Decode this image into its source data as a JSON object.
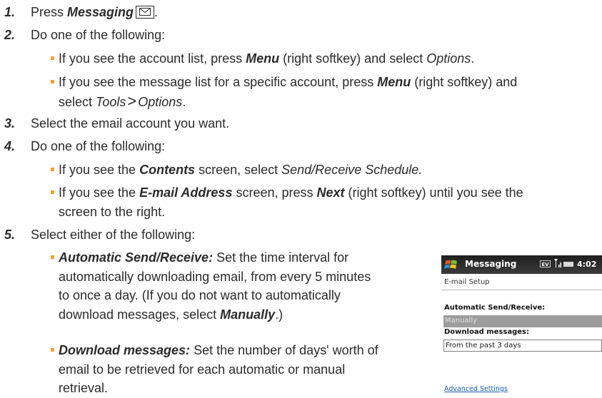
{
  "steps": [
    {
      "num": "1.",
      "parts": {
        "a": "Press ",
        "b": "Messaging"
      }
    },
    {
      "num": "2.",
      "text": "Do one of the following:"
    },
    {
      "num": "3.",
      "text": "Select the email account you want."
    },
    {
      "num": "4.",
      "text": "Do one of the following:"
    },
    {
      "num": "5.",
      "text": "Select either of the following:"
    }
  ],
  "step2_bullets": {
    "b1": {
      "a": "If you see the account list, press ",
      "b": "Menu",
      "c": " (right softkey) and select ",
      "d": "Options",
      "e": "."
    },
    "b2": {
      "a": "If you see the message list for a specific account, press ",
      "b": "Menu",
      "c": " (right softkey) and",
      "d": "select ",
      "e": "Tools",
      "f": ">",
      "g": "Options",
      "h": "."
    }
  },
  "step4_bullets": {
    "b1": {
      "a": "If you see the ",
      "b": "Contents",
      "c": " screen, select ",
      "d": "Send/Receive Schedule."
    },
    "b2": {
      "a": "If you see the ",
      "b": "E-mail Address",
      "c": " screen, press ",
      "d": "Next",
      "e": " (right softkey) until you see the",
      "f": "screen to the right."
    }
  },
  "step5_bullets": {
    "b1": {
      "label": "Automatic Send/Receive:",
      "l1": " Set the time interval for",
      "l2": "automatically downloading email, from every 5 minutes",
      "l3": "to once a day. (If you do not want to automatically",
      "l4": "download messages, select ",
      "manual": "Manually",
      "end": ".)"
    },
    "b2": {
      "label": "Download messages:",
      "l1": " Set the number of days' worth of",
      "l2": "email to be retrieved for each automatic or manual",
      "l3": "retrieval."
    }
  },
  "phone": {
    "title": "Messaging",
    "time": "4:02",
    "ev": "EV",
    "subheader": "E-mail Setup",
    "auto_label": "Automatic Send/Receive:",
    "auto_value": "Manually",
    "download_label": "Download messages:",
    "download_value": "From the past 3 days",
    "advanced_link": "Advanced Settings"
  },
  "icons": {
    "messaging_key": "envelope-icon",
    "start": "windows-logo-icon",
    "signal": "signal-icon",
    "battery": "battery-icon"
  },
  "colors": {
    "bullet": "#f7a21b",
    "text": "#2b2b2b",
    "titlebar": "#1e1e1e",
    "selected_field": "#9c9c9c",
    "link": "#1a5fb4"
  }
}
